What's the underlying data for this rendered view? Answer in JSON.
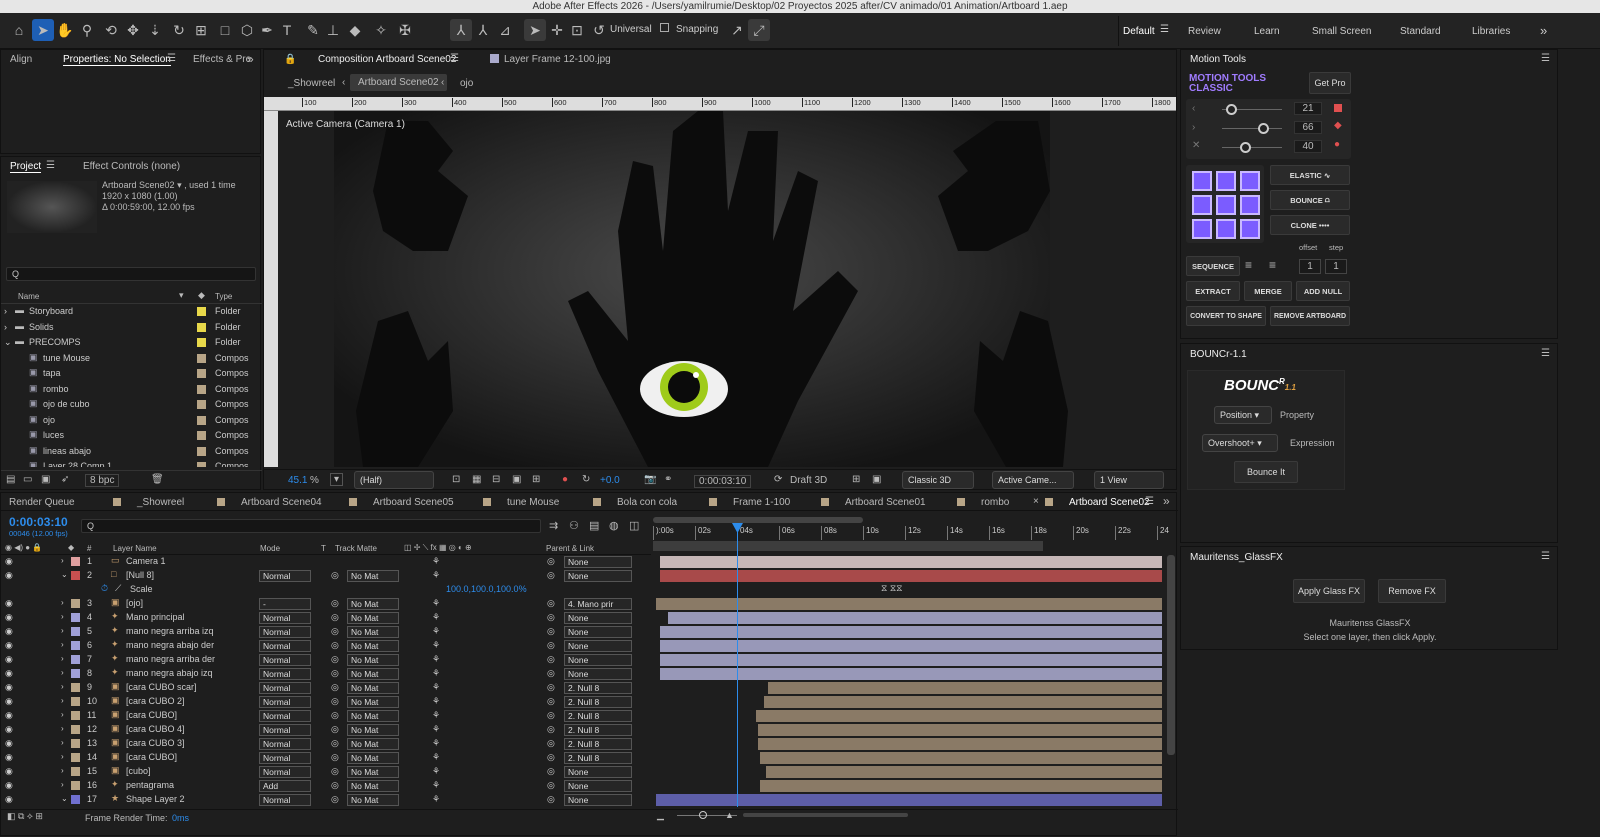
{
  "window": {
    "title": "Adobe After Effects 2026 - /Users/yamilrumie/Desktop/02 Proyectos 2025 after/CV animado/01 Animation/Artboard 1.aep"
  },
  "toolbar": {
    "universal": "Universal",
    "snapping": "Snapping"
  },
  "workspaces": [
    "Default",
    "Review",
    "Learn",
    "Small Screen",
    "Standard",
    "Libraries"
  ],
  "left_tabs": {
    "align": "Align",
    "properties": "Properties: No Selection",
    "effects": "Effects & Pre"
  },
  "project": {
    "tab": "Project",
    "effect_controls": "Effect Controls (none)",
    "item_name": "Artboard Scene02",
    "item_used": ", used 1 time",
    "item_size": "1920 x 1080 (1.00)",
    "item_dur": "Δ 0:00:59:00, 12.00 fps",
    "search": "Q",
    "col_name": "Name",
    "col_type": "Type",
    "bpc": "8 bpc",
    "items": [
      {
        "name": "Storyboard",
        "type": "Folder",
        "color": "#e8d84a",
        "folder": true
      },
      {
        "name": "Solids",
        "type": "Folder",
        "color": "#e8d84a",
        "folder": true
      },
      {
        "name": "PRECOMPS",
        "type": "Folder",
        "color": "#e8d84a",
        "folder": true
      },
      {
        "name": "tune Mouse",
        "type": "Compos",
        "color": "#b8a587",
        "folder": false
      },
      {
        "name": "tapa",
        "type": "Compos",
        "color": "#b8a587",
        "folder": false
      },
      {
        "name": "rombo",
        "type": "Compos",
        "color": "#b8a587",
        "folder": false
      },
      {
        "name": "ojo de cubo",
        "type": "Compos",
        "color": "#b8a587",
        "folder": false
      },
      {
        "name": "ojo",
        "type": "Compos",
        "color": "#b8a587",
        "folder": false
      },
      {
        "name": "luces",
        "type": "Compos",
        "color": "#b8a587",
        "folder": false
      },
      {
        "name": "lineas abajo",
        "type": "Compos",
        "color": "#b8a587",
        "folder": false
      },
      {
        "name": "Layer 28 Comp 1",
        "type": "Compos",
        "color": "#b8a587",
        "folder": false
      }
    ]
  },
  "comp": {
    "tab": "Composition Artboard Scene02",
    "layer_tab": "Layer Frame 12-100.jpg",
    "crumbs": [
      "_Showreel",
      "Artboard Scene02",
      "ojo"
    ],
    "active_camera": "Active Camera (Camera 1)",
    "rulers": [
      "100",
      "200",
      "300",
      "400",
      "500",
      "600",
      "700",
      "800",
      "900",
      "1000",
      "1100",
      "1200",
      "1300",
      "1400",
      "1500",
      "1600",
      "1700",
      "1800"
    ],
    "zoom": "45.1",
    "zoom_unit": "%",
    "resolution": "(Half)",
    "exposure": "+0.0",
    "timecode": "0:00:03:10",
    "draft": "Draft 3D",
    "renderer": "Classic 3D",
    "camera": "Active Came...",
    "views": "1 View"
  },
  "motion_tools": {
    "panel": "Motion Tools",
    "title1": "MOTION TOOLS",
    "title2": "CLASSIC",
    "get_pro": "Get Pro",
    "v1": "21",
    "v2": "66",
    "v3": "40",
    "elastic": "ELASTIC",
    "bounce": "BOUNCE",
    "clone": "CLONE",
    "offset": "offset",
    "step": "step",
    "sequence": "SEQUENCE",
    "off_val": "1",
    "step_val": "1",
    "extract": "EXTRACT",
    "merge": "MERGE",
    "add_null": "ADD NULL",
    "convert": "CONVERT TO SHAPE",
    "remove": "REMOVE ARTBOARD"
  },
  "bouncr": {
    "panel": "BOUNCr-1.1",
    "logo": "BOUNC",
    "logo_r": "R",
    "logo_ver": "1.1",
    "position": "Position",
    "property": "Property",
    "overshoot": "Overshoot+",
    "expression": "Expression",
    "bounce_it": "Bounce It"
  },
  "glass": {
    "panel": "Mauritenss_GlassFX",
    "apply": "Apply Glass FX",
    "remove": "Remove FX",
    "name": "Mauritenss GlassFX",
    "hint": "Select one layer, then click Apply."
  },
  "timeline": {
    "tabs": [
      "Render Queue",
      "_Showreel",
      "Artboard Scene04",
      "Artboard Scene05",
      "tune Mouse",
      "Bola con cola",
      "Frame 1-100",
      "Artboard Scene01",
      "rombo",
      "Artboard Scene02"
    ],
    "timecode": "0:00:03:10",
    "frame": "00046 (12.00 fps)",
    "search": "Q",
    "cols": {
      "layer_name": "Layer Name",
      "mode": "Mode",
      "t": "T",
      "track_matte": "Track Matte",
      "parent": "Parent & Link",
      "num": "#"
    },
    "ticks": [
      "):00s",
      "02s",
      "04s",
      "06s",
      "08s",
      "10s",
      "12s",
      "14s",
      "16s",
      "18s",
      "20s",
      "22s",
      "24"
    ],
    "scale_label": "Scale",
    "scale_value": "100.0,100.0,100.0%",
    "layers": [
      {
        "n": "1",
        "name": "Camera 1",
        "color": "#e0a0a0",
        "mode": "",
        "matte": "",
        "parent": "None",
        "icon": "cam"
      },
      {
        "n": "2",
        "name": "[Null 8]",
        "color": "#c85050",
        "mode": "Normal",
        "matte": "No Mat",
        "parent": "None",
        "icon": "null"
      },
      {
        "n": "3",
        "name": "[ojo]",
        "color": "#b8a587",
        "mode": "-",
        "matte": "No Mat",
        "parent": "4. Mano prir",
        "icon": "comp"
      },
      {
        "n": "4",
        "name": "Mano principal",
        "color": "#a0a0d8",
        "mode": "Normal",
        "matte": "No Mat",
        "parent": "None",
        "icon": "shape"
      },
      {
        "n": "5",
        "name": "mano negra arriba izq",
        "color": "#a0a0d8",
        "mode": "Normal",
        "matte": "No Mat",
        "parent": "None",
        "icon": "shape"
      },
      {
        "n": "6",
        "name": "mano negra abajo der",
        "color": "#a0a0d8",
        "mode": "Normal",
        "matte": "No Mat",
        "parent": "None",
        "icon": "shape"
      },
      {
        "n": "7",
        "name": "mano negra arriba der",
        "color": "#a0a0d8",
        "mode": "Normal",
        "matte": "No Mat",
        "parent": "None",
        "icon": "shape"
      },
      {
        "n": "8",
        "name": "mano negra abajo izq",
        "color": "#a0a0d8",
        "mode": "Normal",
        "matte": "No Mat",
        "parent": "None",
        "icon": "shape"
      },
      {
        "n": "9",
        "name": "[cara CUBO scar]",
        "color": "#b8a587",
        "mode": "Normal",
        "matte": "No Mat",
        "parent": "2. Null 8",
        "icon": "comp"
      },
      {
        "n": "10",
        "name": "[cara CUBO 2]",
        "color": "#b8a587",
        "mode": "Normal",
        "matte": "No Mat",
        "parent": "2. Null 8",
        "icon": "comp"
      },
      {
        "n": "11",
        "name": "[cara CUBO]",
        "color": "#b8a587",
        "mode": "Normal",
        "matte": "No Mat",
        "parent": "2. Null 8",
        "icon": "comp"
      },
      {
        "n": "12",
        "name": "[cara CUBO 4]",
        "color": "#b8a587",
        "mode": "Normal",
        "matte": "No Mat",
        "parent": "2. Null 8",
        "icon": "comp"
      },
      {
        "n": "13",
        "name": "[cara CUBO 3]",
        "color": "#b8a587",
        "mode": "Normal",
        "matte": "No Mat",
        "parent": "2. Null 8",
        "icon": "comp"
      },
      {
        "n": "14",
        "name": "[cara CUBO]",
        "color": "#b8a587",
        "mode": "Normal",
        "matte": "No Mat",
        "parent": "2. Null 8",
        "icon": "comp"
      },
      {
        "n": "15",
        "name": "[cubo]",
        "color": "#b8a587",
        "mode": "Normal",
        "matte": "No Mat",
        "parent": "None",
        "icon": "comp"
      },
      {
        "n": "16",
        "name": "pentagrama",
        "color": "#b8a587",
        "mode": "Add",
        "matte": "No Mat",
        "parent": "None",
        "icon": "shape"
      },
      {
        "n": "17",
        "name": "Shape Layer 2",
        "color": "#7070d0",
        "mode": "Normal",
        "matte": "No Mat",
        "parent": "None",
        "icon": "star"
      }
    ],
    "footer": "Frame Render Time:",
    "footer_val": "0ms"
  },
  "colors": {
    "accent": "#2d8ceb",
    "purple": "#7b5cff",
    "red": "#e05050"
  }
}
